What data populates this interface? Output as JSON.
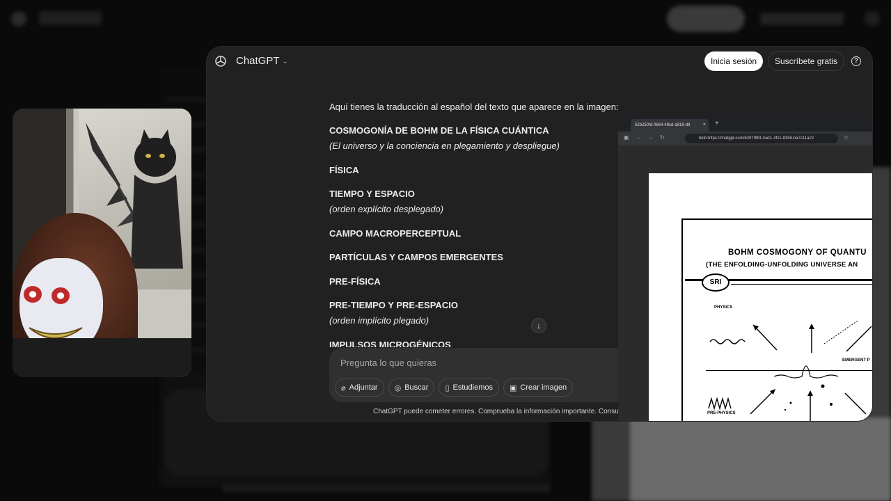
{
  "window": {
    "model_name": "ChatGPT",
    "login_label": "Inicia sesión",
    "signup_label": "Suscríbete gratis",
    "help_glyph": "?"
  },
  "message": {
    "intro": "Aquí tienes la traducción al español del texto que aparece en la imagen:",
    "lines": [
      {
        "text": "COSMOGONÍA DE BOHM DE LA FÍSICA CUÁNTICA",
        "style": "bold"
      },
      {
        "text": "(El universo y la conciencia en plegamiento y despliegue)",
        "style": "italic"
      },
      {
        "text": "FÍSICA",
        "style": "bold"
      },
      {
        "text": "TIEMPO Y ESPACIO",
        "style": "bold"
      },
      {
        "text": "(orden explícito desplegado)",
        "style": "italic"
      },
      {
        "text": "CAMPO MACROPERCEPTUAL",
        "style": "bold"
      },
      {
        "text": "PARTÍCULAS Y CAMPOS EMERGENTES",
        "style": "bold"
      },
      {
        "text": "PRE-FÍSICA",
        "style": "bold"
      },
      {
        "text": "PRE-TIEMPO Y PRE-ESPACIO",
        "style": "bold"
      },
      {
        "text": "(orden implícito plegado)",
        "style": "italic"
      },
      {
        "text": "IMPULSOS MICROGÉNICOS",
        "style": "bold"
      }
    ]
  },
  "composer": {
    "placeholder": "Pregunta lo que quieras",
    "tools": [
      {
        "label": "Adjuntar",
        "icon": "paperclip-icon",
        "glyph": "📎"
      },
      {
        "label": "Buscar",
        "icon": "globe-icon",
        "glyph": "🌐"
      },
      {
        "label": "Estudiemos",
        "icon": "book-icon",
        "glyph": "📖"
      },
      {
        "label": "Crear imagen",
        "icon": "image-icon",
        "glyph": "🖼"
      }
    ]
  },
  "disclaimer": "ChatGPT puede cometer errores. Comprueba la información importante. Consu",
  "browser": {
    "tab_title": "52b250fd-0b64-49cd-a818-d9",
    "url": "blob:https://chatgpt.com/62079f81-ba11-4f11-8358-ba7c11a22",
    "document": {
      "title": "BOHM COSMOGONY OF QUANTU",
      "subtitle": "(THE ENFOLDING-UNFOLDING UNIVERSE AN",
      "logo_text": "SRI",
      "label_physics": "PHYSICS",
      "label_emergent": "EMERGENT P",
      "label_prephysics": "PRE-PHYSICS"
    }
  },
  "colors": {
    "window_bg": "#212121",
    "composer_bg": "#303030",
    "login_bg": "#ffffff"
  }
}
